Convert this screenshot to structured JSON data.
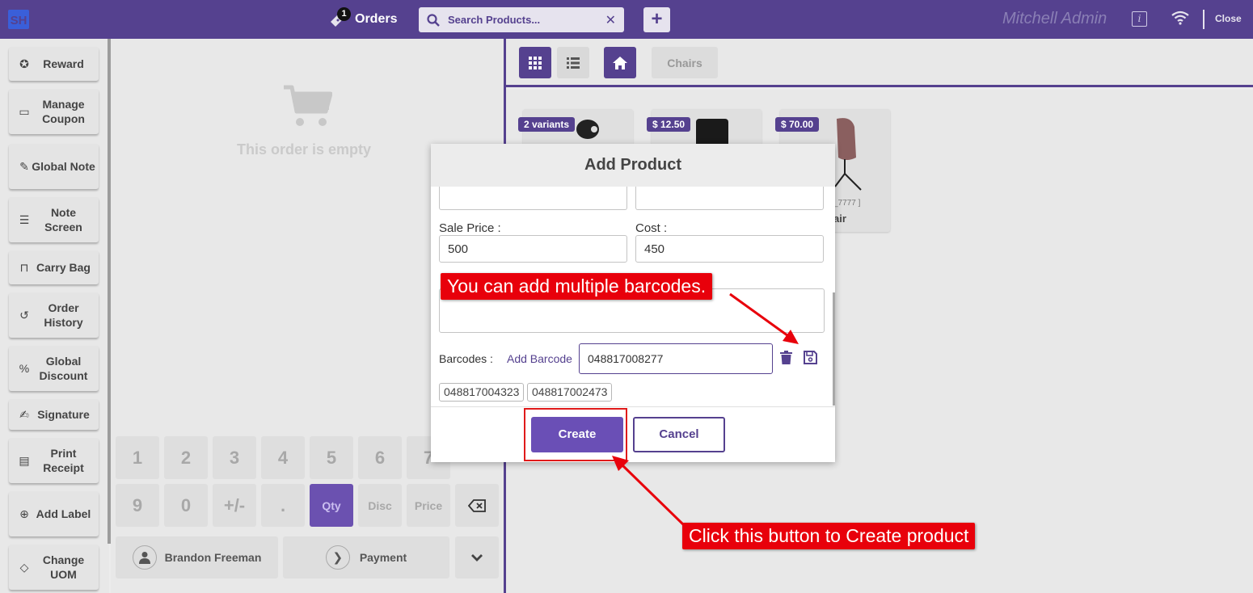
{
  "topbar": {
    "orders_label": "Orders",
    "orders_count": "1",
    "search_placeholder": "Search Products...",
    "user_name": "Mitchell Admin",
    "info_glyph": "i",
    "close_label": "Close"
  },
  "left_buttons": [
    {
      "label": "Reward",
      "icon": "reward-icon"
    },
    {
      "label": "Manage Coupon",
      "icon": "coupon-icon"
    },
    {
      "label": "Global Note",
      "icon": "note-edit-icon"
    },
    {
      "label": "Note Screen",
      "icon": "note-screen-icon"
    },
    {
      "label": "Carry Bag",
      "icon": "bag-icon"
    },
    {
      "label": "Order History",
      "icon": "history-icon"
    },
    {
      "label": "Global Discount",
      "icon": "discount-icon"
    },
    {
      "label": "Signature",
      "icon": "signature-icon"
    },
    {
      "label": "Print Receipt",
      "icon": "receipt-icon"
    },
    {
      "label": "Add Label",
      "icon": "add-circle-icon"
    },
    {
      "label": "Change UOM",
      "icon": "tag-icon"
    }
  ],
  "order": {
    "empty_text": "This order is empty",
    "customer_label": "Brandon Freeman",
    "payment_label": "Payment"
  },
  "numpad": {
    "row1": [
      "1",
      "2",
      "3",
      "4",
      "5",
      "6",
      "7"
    ],
    "row2": [
      "9",
      "0",
      "+/-",
      ".",
      "Qty",
      "Disc",
      "Price"
    ]
  },
  "products": {
    "category_label": "Chairs",
    "cards": [
      {
        "tag": "2 variants",
        "name": ""
      },
      {
        "tag": "$ 12.50",
        "name": ""
      },
      {
        "tag": "$ 70.00",
        "ref": "_7777 ]",
        "name": "air"
      }
    ]
  },
  "modal": {
    "title": "Add Product",
    "sale_price_label": "Sale Price :",
    "sale_price_value": "500",
    "cost_label": "Cost :",
    "cost_value": "450",
    "barcodes_label": "Barcodes :",
    "add_barcode_label": "Add Barcode",
    "barcode_input_value": "048817008277",
    "barcode_chips": [
      "048817004323",
      "048817002473"
    ],
    "create_label": "Create",
    "cancel_label": "Cancel"
  },
  "annotations": {
    "barcodes_note": "You can add multiple barcodes.",
    "create_note": "Click this button to Create product"
  },
  "colors": {
    "brand": "#55418f",
    "primary_button": "#6a4fb6",
    "callout": "#e8000b",
    "background": "#e8e8e8"
  }
}
